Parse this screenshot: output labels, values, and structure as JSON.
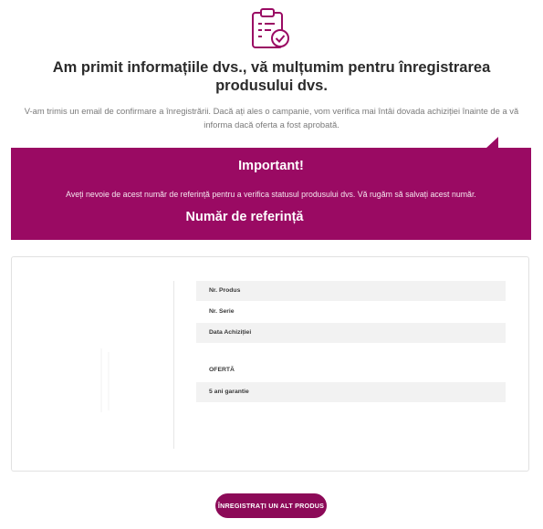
{
  "header": {
    "icon": "clipboard-check-icon",
    "title": "Am primit informațiile dvs., vă mulțumim pentru înregistrarea produsului dvs.",
    "message": "V-am trimis un email de confirmare a înregistrării. Dacă ați ales o campanie, vom verifica mai întâi dovada achiziției înainte de a vă informa dacă oferta a fost aprobată."
  },
  "banner": {
    "title": "Important!",
    "text": "Aveți nevoie de acest număr de referință pentru a verifica statusul produsului dvs. Vă rugăm să salvați acest număr.",
    "reference_label": "Număr de referință",
    "color": "#9a0a63"
  },
  "product": {
    "rows": [
      {
        "label": "Nr. Produs"
      },
      {
        "label": "Nr. Serie"
      },
      {
        "label": "Data Achiziției"
      },
      {
        "label": "OFERTĂ"
      },
      {
        "label": "5 ani garantie"
      }
    ]
  },
  "actions": {
    "register_another": "ÎNREGISTRAȚI UN ALT PRODUS",
    "button_color": "#8c0a58"
  }
}
